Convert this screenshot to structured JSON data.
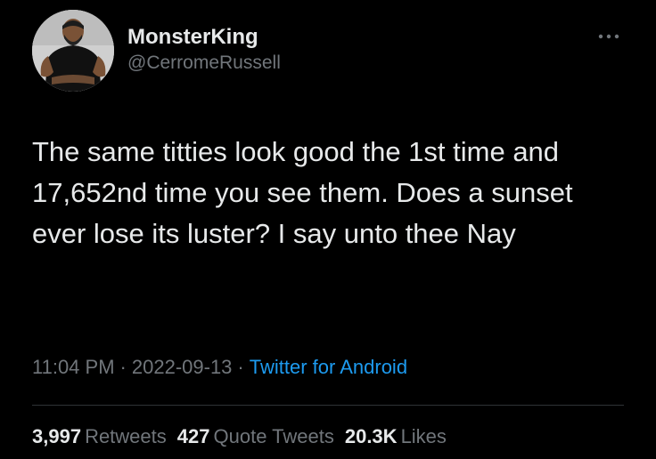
{
  "tweet": {
    "display_name": "MonsterKing",
    "handle": "@CerromeRussell",
    "text": "The same titties look good the 1st time and 17,652nd time you see them. Does a sunset ever lose its luster? I say unto thee Nay",
    "time": "11:04 PM",
    "separator": "·",
    "date": "2022-09-13",
    "source": "Twitter for Android",
    "stats": {
      "retweets": {
        "count": "3,997",
        "label": "Retweets"
      },
      "quote_tweets": {
        "count": "427",
        "label": "Quote Tweets"
      },
      "likes": {
        "count": "20.3K",
        "label": "Likes"
      }
    }
  },
  "icons": {
    "avatar": "profile-photo",
    "more": "more-horizontal-icon"
  },
  "colors": {
    "background": "#000000",
    "primary_text": "#e7e9ea",
    "secondary_text": "#71767b",
    "link": "#1d9bf0",
    "divider": "#2f3336"
  }
}
